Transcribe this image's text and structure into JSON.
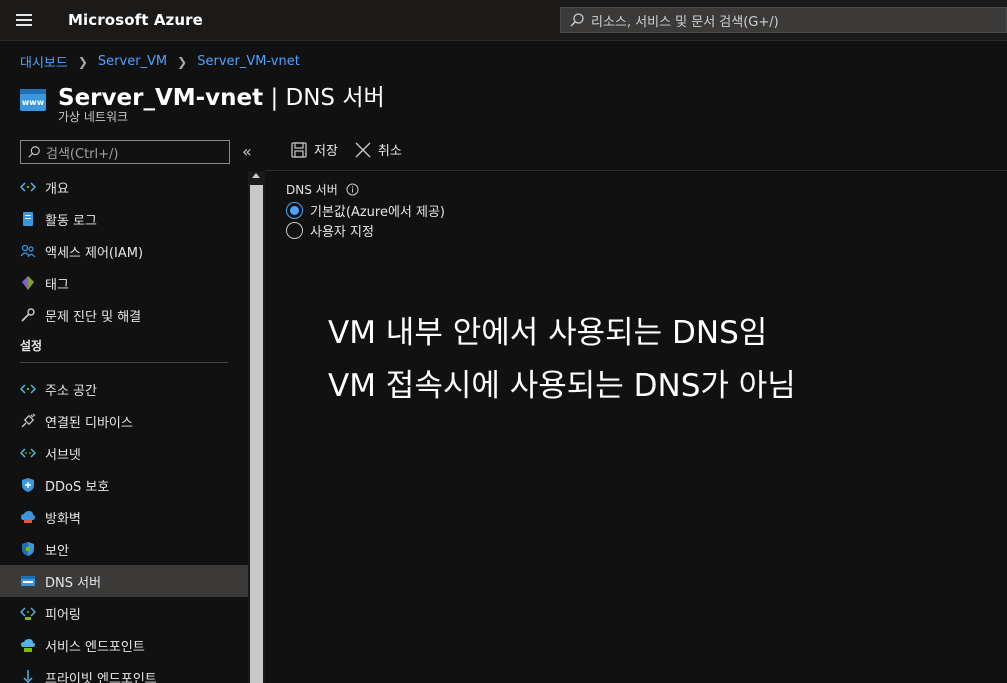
{
  "header": {
    "brand": "Microsoft Azure",
    "search_placeholder": "리소스, 서비스 및 문서 검색(G+/)"
  },
  "breadcrumb": [
    "대시보드",
    "Server_VM",
    "Server_VM-vnet"
  ],
  "page": {
    "title_bold": "Server_VM-vnet",
    "title_rest": " | DNS 서버",
    "subtitle": "가상 네트워크"
  },
  "sidebar": {
    "search_placeholder": "검색(Ctrl+/)",
    "collapse_label": "«",
    "items_top": [
      {
        "label": "개요",
        "icon": "overview-icon"
      },
      {
        "label": "활동 로그",
        "icon": "activity-log-icon"
      },
      {
        "label": "액세스 제어(IAM)",
        "icon": "iam-icon"
      },
      {
        "label": "태그",
        "icon": "tag-icon"
      },
      {
        "label": "문제 진단 및 해결",
        "icon": "wrench-icon"
      }
    ],
    "section_label": "설정",
    "items_settings": [
      {
        "label": "주소 공간",
        "icon": "address-space-icon"
      },
      {
        "label": "연결된 디바이스",
        "icon": "plug-icon"
      },
      {
        "label": "서브넷",
        "icon": "subnet-icon"
      },
      {
        "label": "DDoS 보호",
        "icon": "ddos-shield-icon"
      },
      {
        "label": "방화벽",
        "icon": "firewall-icon"
      },
      {
        "label": "보안",
        "icon": "security-shield-icon"
      },
      {
        "label": "DNS 서버",
        "icon": "dns-icon",
        "active": true
      },
      {
        "label": "피어링",
        "icon": "peering-icon"
      },
      {
        "label": "서비스 엔드포인트",
        "icon": "service-endpoint-icon"
      },
      {
        "label": "프라이빗 엔드포인트",
        "icon": "private-endpoint-icon"
      }
    ]
  },
  "commands": {
    "save_label": "저장",
    "cancel_label": "취소"
  },
  "dns": {
    "field_label": "DNS 서버",
    "options": [
      {
        "label": "기본값(Azure에서 제공)",
        "checked": true
      },
      {
        "label": "사용자 지정",
        "checked": false
      }
    ]
  },
  "annotation": {
    "line1": "VM 내부 안에서 사용되는 DNS임",
    "line2": "VM 접속시에 사용되는 DNS가 아님"
  },
  "colors": {
    "accent": "#4ea0ff",
    "background": "#111111",
    "topbar": "#1b1a19",
    "active_item": "#3b3a39"
  }
}
